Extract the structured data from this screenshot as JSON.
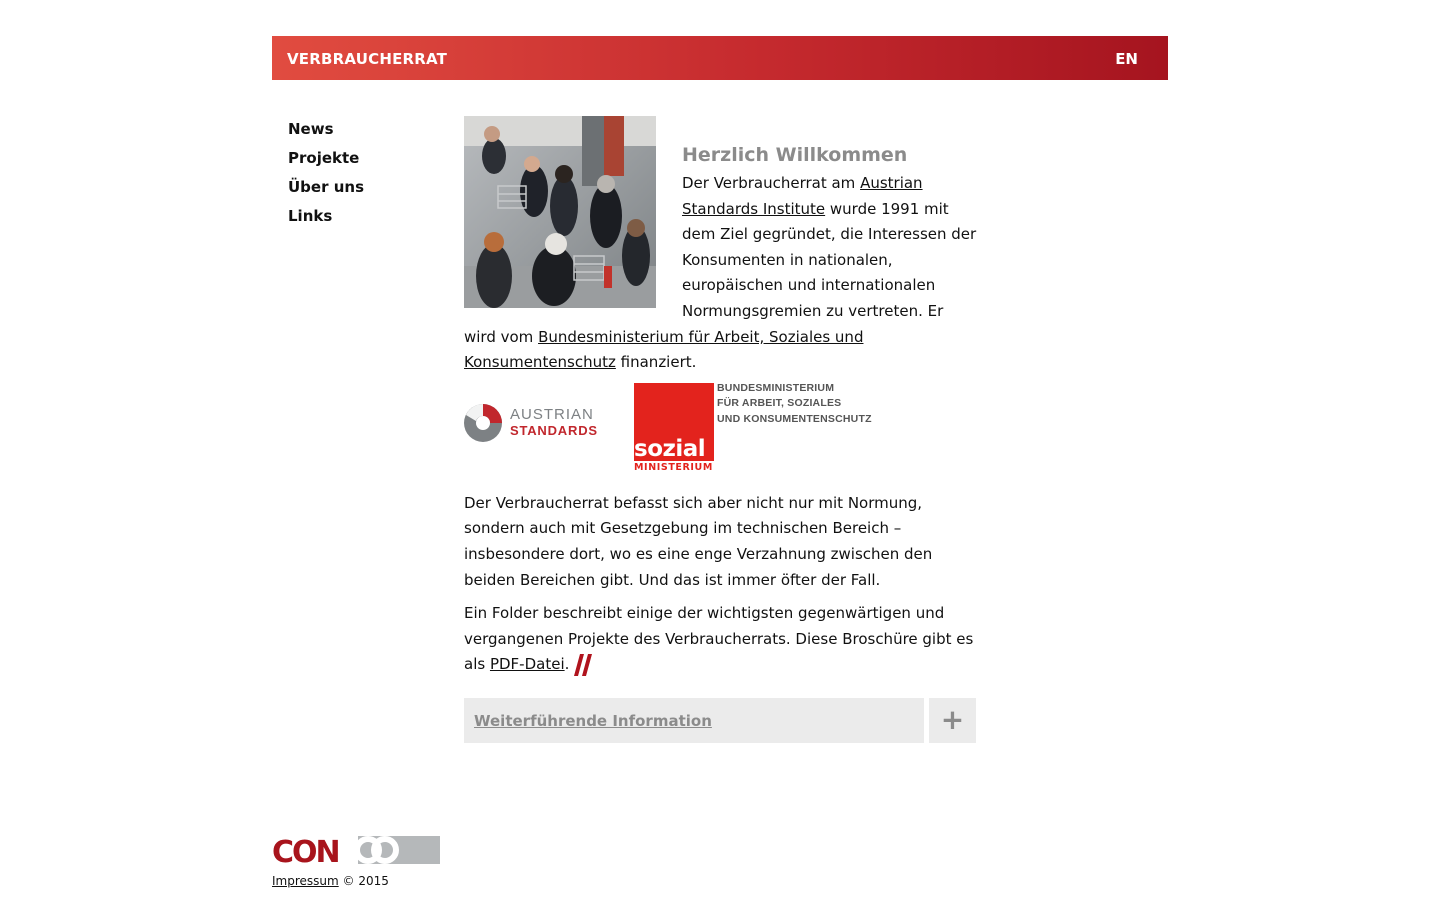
{
  "header": {
    "brand": "VERBRAUCHERRAT",
    "lang": "EN"
  },
  "nav": [
    {
      "label": "News"
    },
    {
      "label": "Projekte"
    },
    {
      "label": "Über uns"
    },
    {
      "label": "Links"
    }
  ],
  "main": {
    "welcome_title": "Herzlich Willkommen",
    "intro_1": "Der Verbraucherrat am ",
    "intro_link_1": "Austrian Standards Institute",
    "intro_2": " wurde 1991 mit dem Ziel gegründet, die Interessen der Konsumenten in nationalen, europäischen und internationalen Normungsgremien zu vertreten. Er wird vom ",
    "intro_link_2": "Bundesministerium für Arbeit, Soziales und Konsumentenschutz",
    "intro_3": " finanziert.",
    "paragraph_2": "Der Verbraucherrat befasst sich aber nicht nur mit Normung, sondern auch mit Gesetzgebung im technischen Bereich – insbesondere dort, wo es eine enge Verzahnung zwischen den beiden Bereichen gibt. Und das ist immer öfter der Fall.",
    "paragraph_3_text": "Ein Folder beschreibt einige der wichtigsten gegenwärtigen und vergangenen Projekte des Verbraucherrats. Diese Broschüre gibt es als ",
    "paragraph_3_link": "PDF-Datei",
    "paragraph_3_end": "."
  },
  "logos": {
    "austrian_standards": {
      "line1": "AUSTRIAN",
      "line2": "STANDARDS"
    },
    "sozialministerium": {
      "big": "sozial",
      "small": "MINISTERIUM",
      "line1": "BUNDESMINISTERIUM",
      "line2": "FÜR ARBEIT, SOZIALES",
      "line3": "UND KONSUMENTENSCHUTZ"
    }
  },
  "info": {
    "label": "Weiterführende Information",
    "toggle": "+"
  },
  "footer": {
    "logo_text": "CONCO",
    "impressum": "Impressum",
    "copyright": " © 2015"
  },
  "colors": {
    "header_start": "#e14c40",
    "header_end": "#a5141f",
    "accent_red": "#e3231d",
    "gray": "#8b8b8b"
  }
}
